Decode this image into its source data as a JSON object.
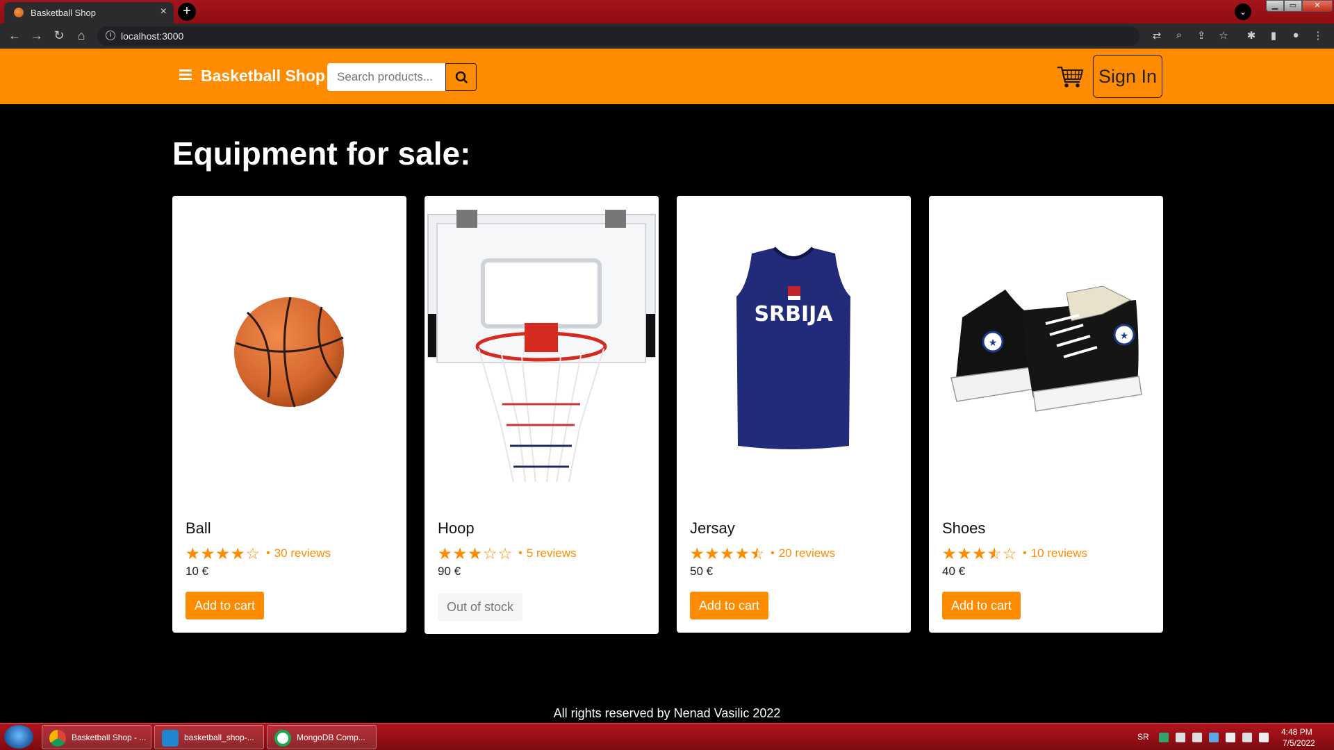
{
  "browser": {
    "tab_title": "Basketball Shop",
    "tab_close": "×",
    "new_tab": "+",
    "url": "localhost:3000"
  },
  "navbar": {
    "brand": "Basketball Shop",
    "search_placeholder": "Search products...",
    "signin_label": "Sign In"
  },
  "page": {
    "heading": "Equipment for sale:"
  },
  "products": [
    {
      "name": "Ball",
      "rating": 4,
      "reviews": "30 reviews",
      "price": "10 €",
      "button": "Add to cart",
      "in_stock": true
    },
    {
      "name": "Hoop",
      "rating": 3,
      "reviews": "5 reviews",
      "price": "90 €",
      "button": "Out of stock",
      "in_stock": false
    },
    {
      "name": "Jersay",
      "rating": 4.5,
      "reviews": "20 reviews",
      "price": "50 €",
      "button": "Add to cart",
      "in_stock": true
    },
    {
      "name": "Shoes",
      "rating": 3.5,
      "reviews": "10 reviews",
      "price": "40 €",
      "button": "Add to cart",
      "in_stock": true
    }
  ],
  "footer": {
    "text": "All rights reserved by Nenad Vasilic 2022"
  },
  "taskbar": {
    "items": [
      "Basketball Shop - ...",
      "basketball_shop-...",
      "MongoDB Comp..."
    ],
    "lang": "SR",
    "time": "4:48 PM",
    "date": "7/5/2022"
  },
  "colors": {
    "accent": "#ff8c00",
    "background": "#000000",
    "card": "#ffffff"
  }
}
